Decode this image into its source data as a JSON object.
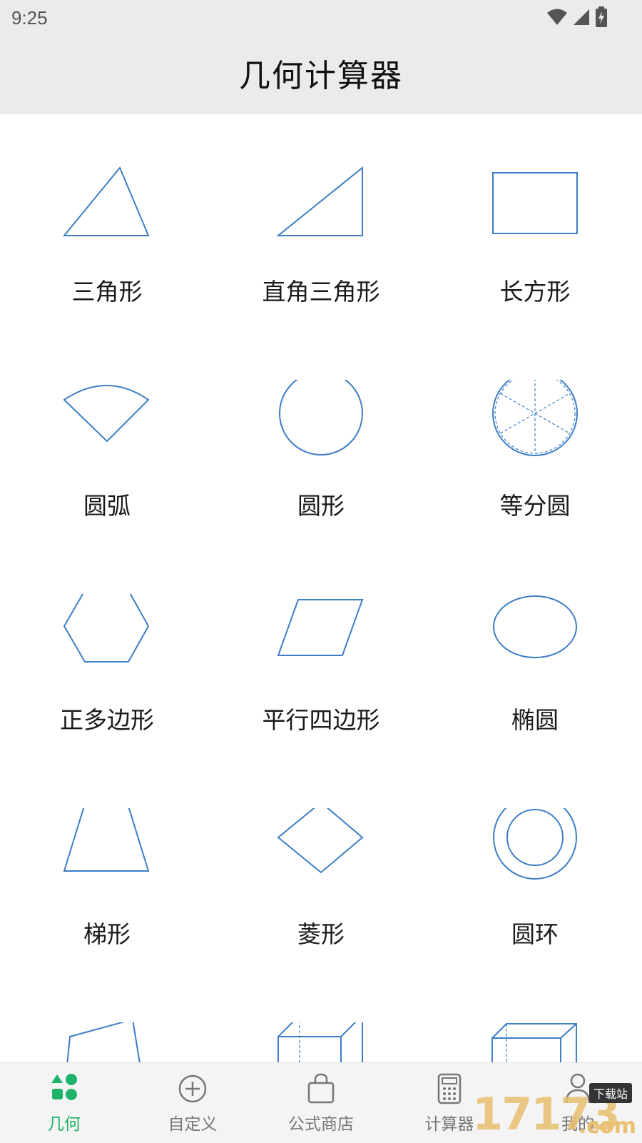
{
  "status_bar": {
    "time": "9:25"
  },
  "header": {
    "title": "几何计算器"
  },
  "shapes": [
    {
      "label": "三角形"
    },
    {
      "label": "直角三角形"
    },
    {
      "label": "长方形"
    },
    {
      "label": "圆弧"
    },
    {
      "label": "圆形"
    },
    {
      "label": "等分圆"
    },
    {
      "label": "正多边形"
    },
    {
      "label": "平行四边形"
    },
    {
      "label": "椭圆"
    },
    {
      "label": "梯形"
    },
    {
      "label": "菱形"
    },
    {
      "label": "圆环"
    }
  ],
  "tabs": [
    {
      "label": "几何",
      "icon": "geometry-icon",
      "active": true
    },
    {
      "label": "自定义",
      "icon": "plus-circle-icon",
      "active": false
    },
    {
      "label": "公式商店",
      "icon": "shopping-bag-icon",
      "active": false
    },
    {
      "label": "计算器",
      "icon": "calculator-icon",
      "active": false
    },
    {
      "label": "我的",
      "icon": "user-icon",
      "active": false
    }
  ],
  "watermark": {
    "text": "17173",
    "badge": "下载站",
    "suffix": ".com"
  },
  "colors": {
    "accent": "#1fb36b",
    "shape_stroke": "#3d7ec6",
    "header_bg": "#ebebeb"
  }
}
